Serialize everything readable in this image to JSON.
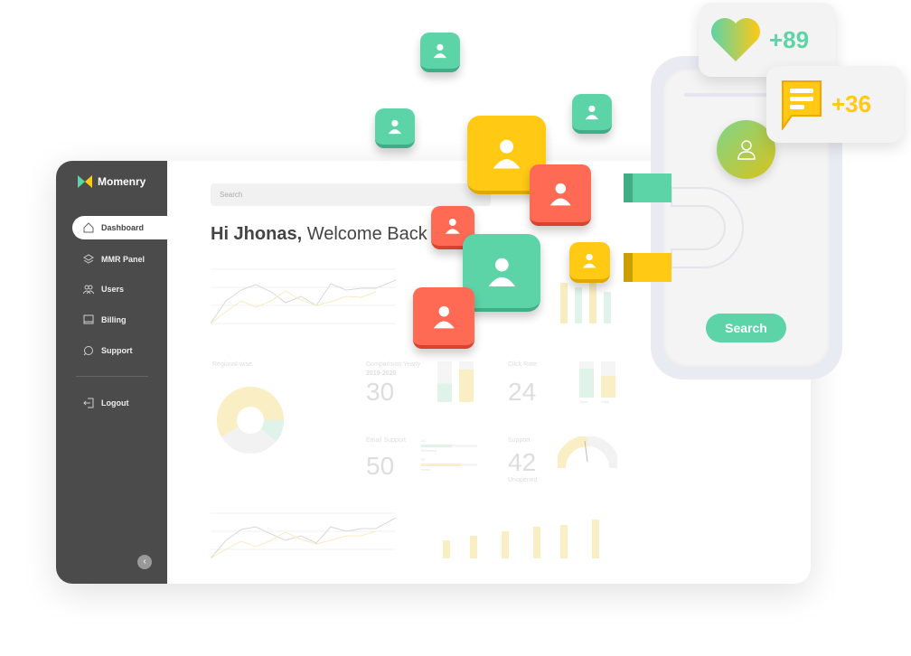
{
  "app": {
    "name": "Momenry"
  },
  "sidebar": {
    "items": [
      {
        "label": "Dashboard",
        "icon": "home-icon"
      },
      {
        "label": "MMR Panel",
        "icon": "layers-icon"
      },
      {
        "label": "Users",
        "icon": "users-icon"
      },
      {
        "label": "Billing",
        "icon": "billing-icon"
      },
      {
        "label": "Support",
        "icon": "support-icon"
      }
    ],
    "logout": "Logout"
  },
  "search": {
    "placeholder": "Search"
  },
  "greeting": {
    "name": "Hi Jhonas,",
    "welcome": "Welcome Back"
  },
  "widgets": {
    "regional": {
      "title": "Regional-wise"
    },
    "comparison": {
      "title": "Comparision Yearly",
      "period": "2019-2020",
      "value": "30"
    },
    "click_rate": {
      "title": "Click Rate",
      "value": "24",
      "labels": [
        "Open",
        "Click"
      ]
    },
    "email": {
      "title": "Email Support",
      "value": "50",
      "bars": [
        {
          "num": "35",
          "label": "Delivered"
        },
        {
          "num": "27",
          "label": "Send"
        }
      ]
    },
    "support": {
      "title": "Support",
      "value": "42",
      "sub": "Unopened"
    }
  },
  "phone": {
    "search_button": "Search",
    "likes": "+89",
    "comments": "+36"
  },
  "colors": {
    "green": "#5dd3a8",
    "yellow": "#ffc914",
    "red": "#ff6a55",
    "sidebar": "#4b4b4b"
  }
}
